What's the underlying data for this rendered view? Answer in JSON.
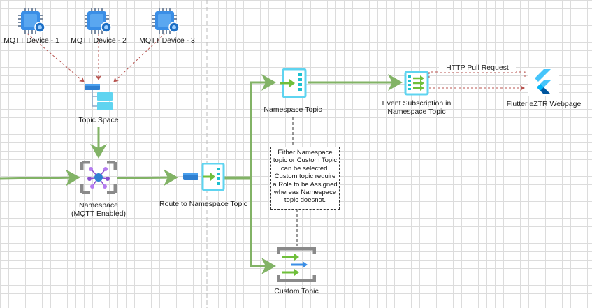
{
  "nodes": {
    "device1": "MQTT Device - 1",
    "device2": "MQTT Device - 2",
    "device3": "MQTT Device - 3",
    "topic_space": "Topic Space",
    "namespace_line1": "Namespace",
    "namespace_line2": "(MQTT Enabled)",
    "route": "Route to Namespace Topic",
    "namespace_topic": "Namespace Topic",
    "custom_topic": "Custom Topic",
    "event_sub_line1": "Event Subscription in",
    "event_sub_line2": "Namespace Topic",
    "flutter": "Flutter eZTR Webpage"
  },
  "edges": {
    "http_pull": "HTTP Pull Request"
  },
  "note": {
    "lines": [
      "Either Namespace",
      "topic or Custom Topic",
      "can be selected.",
      "Custom topic require",
      "a Role to be Assigned",
      "whereas Namespace",
      "topic doesnot."
    ]
  },
  "colors": {
    "green_edge": "#82b366",
    "red_dashed": "#b85450",
    "chip_blue": "#3a8ee6",
    "azure_blue": "#2f80d1",
    "teal": "#1ec0cf",
    "purple": "#8a4fd0"
  },
  "icons": [
    "chip-icon",
    "topic-space-icon",
    "event-grid-namespace-icon",
    "topic-route-icon",
    "namespace-topic-icon",
    "custom-topic-icon",
    "event-subscription-icon",
    "flutter-logo-icon"
  ]
}
